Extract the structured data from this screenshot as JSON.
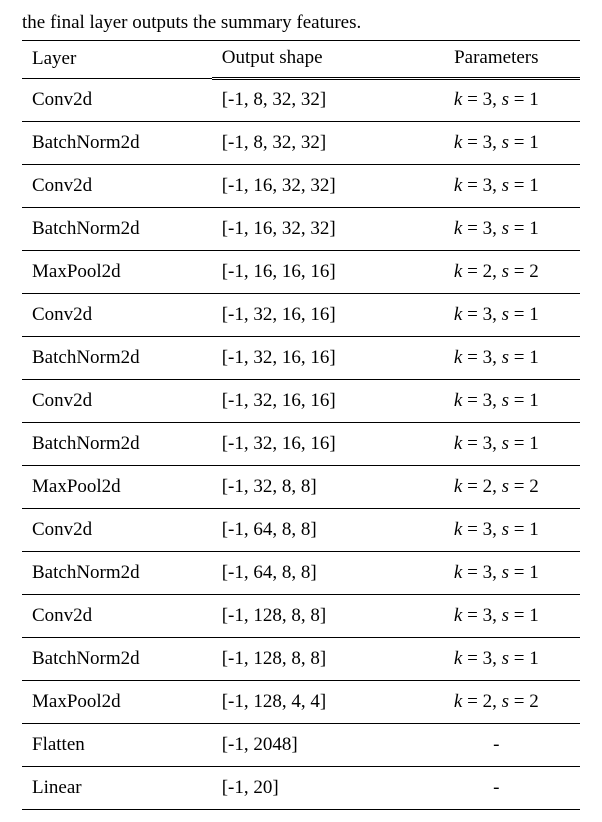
{
  "caption_fragment": "the final layer outputs the summary features.",
  "headers": {
    "layer": "Layer",
    "shape": "Output shape",
    "params": "Parameters"
  },
  "rows": [
    {
      "layer": "Conv2d",
      "shape": "[-1, 8, 32, 32]",
      "k": "3",
      "s": "1"
    },
    {
      "layer": "BatchNorm2d",
      "shape": "[-1, 8, 32, 32]",
      "k": "3",
      "s": "1"
    },
    {
      "layer": "Conv2d",
      "shape": "[-1, 16, 32, 32]",
      "k": "3",
      "s": "1"
    },
    {
      "layer": "BatchNorm2d",
      "shape": "[-1, 16, 32, 32]",
      "k": "3",
      "s": "1"
    },
    {
      "layer": "MaxPool2d",
      "shape": "[-1, 16, 16, 16]",
      "k": "2",
      "s": "2"
    },
    {
      "layer": "Conv2d",
      "shape": "[-1, 32, 16, 16]",
      "k": "3",
      "s": "1"
    },
    {
      "layer": "BatchNorm2d",
      "shape": "[-1, 32, 16, 16]",
      "k": "3",
      "s": "1"
    },
    {
      "layer": "Conv2d",
      "shape": "[-1, 32, 16, 16]",
      "k": "3",
      "s": "1"
    },
    {
      "layer": "BatchNorm2d",
      "shape": "[-1, 32, 16, 16]",
      "k": "3",
      "s": "1"
    },
    {
      "layer": "MaxPool2d",
      "shape": "[-1, 32, 8, 8]",
      "k": "2",
      "s": "2"
    },
    {
      "layer": "Conv2d",
      "shape": "[-1, 64, 8, 8]",
      "k": "3",
      "s": "1"
    },
    {
      "layer": "BatchNorm2d",
      "shape": "[-1, 64, 8, 8]",
      "k": "3",
      "s": "1"
    },
    {
      "layer": "Conv2d",
      "shape": "[-1, 128, 8, 8]",
      "k": "3",
      "s": "1"
    },
    {
      "layer": "BatchNorm2d",
      "shape": "[-1, 128, 8, 8]",
      "k": "3",
      "s": "1"
    },
    {
      "layer": "MaxPool2d",
      "shape": "[-1, 128, 4, 4]",
      "k": "2",
      "s": "2"
    },
    {
      "layer": "Flatten",
      "shape": "[-1, 2048]",
      "k": null,
      "s": null
    },
    {
      "layer": "Linear",
      "shape": "[-1, 20]",
      "k": null,
      "s": null
    }
  ]
}
